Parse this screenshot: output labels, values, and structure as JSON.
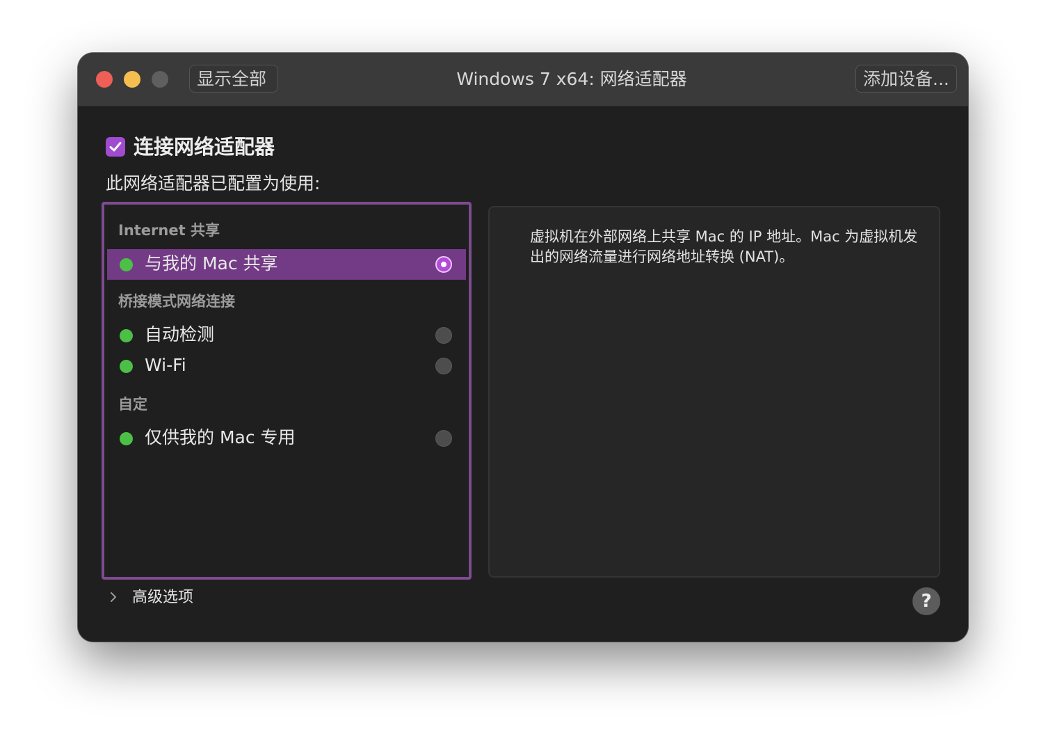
{
  "titlebar": {
    "title": "Windows 7 x64: 网络适配器",
    "show_all_label": "显示全部",
    "add_device_label": "添加设备..."
  },
  "connect": {
    "label": "连接网络适配器",
    "checked": true
  },
  "config_label": "此网络适配器已配置为使用:",
  "sections": [
    {
      "header": "Internet 共享",
      "items": [
        {
          "label": "与我的 Mac 共享",
          "selected": true
        }
      ]
    },
    {
      "header": "桥接模式网络连接",
      "items": [
        {
          "label": "自动检测",
          "selected": false
        },
        {
          "label": "Wi-Fi",
          "selected": false
        }
      ]
    },
    {
      "header": "自定",
      "items": [
        {
          "label": "仅供我的 Mac 专用",
          "selected": false
        }
      ]
    }
  ],
  "description": "虚拟机在外部网络上共享 Mac 的 IP 地址。Mac 为虚拟机发出的网络流量进行网络地址转换 (NAT)。",
  "advanced_label": "高级选项",
  "help_label": "?",
  "colors": {
    "accent": "#a04bd0",
    "selection": "#733a86",
    "status_green": "#4cc046"
  },
  "icons": {
    "close": "close-icon",
    "minimize": "minimize-icon",
    "zoom": "zoom-icon",
    "checkbox": "checkmark-icon",
    "status": "green-dot-icon",
    "radio": "radio-icon",
    "advanced": "chevron-right-icon",
    "help": "question-mark-icon"
  }
}
